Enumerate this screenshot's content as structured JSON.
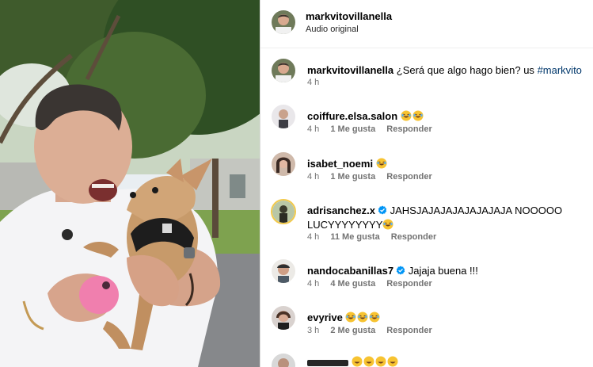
{
  "media": {
    "description_icon": "video-frame"
  },
  "header": {
    "username": "markvitovillanella",
    "subtitle": "Audio original"
  },
  "caption": {
    "username": "markvitovillanella",
    "text": "¿Será que algo hago bien? us ",
    "hashtag": "#markvito",
    "time": "4 h"
  },
  "comments": [
    {
      "username": "coiffure.elsa.salon",
      "text": "",
      "emojis": 2,
      "time": "4 h",
      "likes": "1 Me gusta",
      "reply": "Responder"
    },
    {
      "username": "isabet_noemi",
      "text": "",
      "emojis": 1,
      "time": "4 h",
      "likes": "1 Me gusta",
      "reply": "Responder"
    },
    {
      "username": "adrisanchez.x",
      "verified": true,
      "text": "JAHSJAJAJAJAJAJAJAJA NOOOOO LUCYYYYYYYY",
      "emojis_after": 1,
      "time": "4 h",
      "likes": "11 Me gusta",
      "reply": "Responder"
    },
    {
      "username": "nandocabanillas7",
      "verified": true,
      "text": "Jajaja buena !!!",
      "time": "4 h",
      "likes": "4 Me gusta",
      "reply": "Responder"
    },
    {
      "username": "evyrive",
      "text": "",
      "emojis": 3,
      "time": "3 h",
      "likes": "2 Me gusta",
      "reply": "Responder"
    }
  ],
  "colors": {
    "link": "#00376b",
    "verified": "#0095f6",
    "muted": "#737373",
    "divider": "#dbdbdb"
  }
}
